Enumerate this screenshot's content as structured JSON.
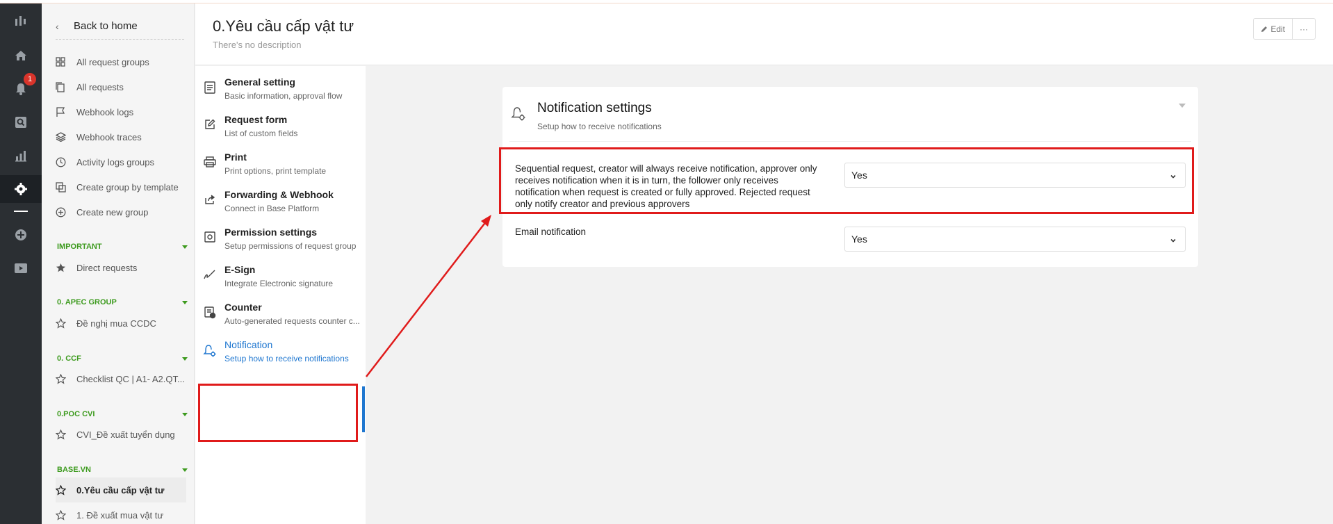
{
  "notification_badge": "1",
  "sidebar": {
    "back_label": "Back to home",
    "items": [
      {
        "label": "All request groups",
        "icon": "grid-icon"
      },
      {
        "label": "All requests",
        "icon": "copy-icon"
      },
      {
        "label": "Webhook logs",
        "icon": "flag-icon"
      },
      {
        "label": "Webhook traces",
        "icon": "layers-icon"
      },
      {
        "label": "Activity logs groups",
        "icon": "clock-icon"
      },
      {
        "label": "Create group by template",
        "icon": "template-icon"
      },
      {
        "label": "Create new group",
        "icon": "plus-circle-icon"
      }
    ],
    "groups": [
      {
        "name": "IMPORTANT",
        "items": [
          "Direct requests"
        ]
      },
      {
        "name": "0. APEC GROUP",
        "items": [
          "Đề nghị mua CCDC"
        ]
      },
      {
        "name": "0. CCF",
        "items": [
          "Checklist QC | A1- A2.QT..."
        ]
      },
      {
        "name": "0.POC CVI",
        "items": [
          "CVI_Đề xuất tuyển dụng"
        ]
      },
      {
        "name": "BASE.VN",
        "items": [
          "0.Yêu cầu cấp vật tư",
          "1. Đề xuất mua vật tư"
        ]
      }
    ]
  },
  "header": {
    "title": "0.Yêu cầu cấp vật tư",
    "description": "There's no description",
    "edit_label": "Edit",
    "more_label": "···"
  },
  "settings_menu": [
    {
      "label": "General setting",
      "sub": "Basic information, approval flow",
      "icon": "document-icon"
    },
    {
      "label": "Request form",
      "sub": "List of custom fields",
      "icon": "edit-icon"
    },
    {
      "label": "Print",
      "sub": "Print options, print template",
      "icon": "printer-icon"
    },
    {
      "label": "Forwarding & Webhook",
      "sub": "Connect in Base Platform",
      "icon": "share-icon"
    },
    {
      "label": "Permission settings",
      "sub": "Setup permissions of request group",
      "icon": "permission-icon"
    },
    {
      "label": "E-Sign",
      "sub": "Integrate Electronic signature",
      "icon": "signature-icon"
    },
    {
      "label": "Counter",
      "sub": "Auto-generated requests counter c...",
      "icon": "counter-icon"
    },
    {
      "label": "Notification",
      "sub": "Setup how to receive notifications",
      "icon": "bell-gear-icon"
    }
  ],
  "card": {
    "title": "Notification settings",
    "subtitle": "Setup how to receive notifications",
    "rows": [
      {
        "label": "Sequential request, creator will always receive notification, approver only receives notification when it is in turn, the follower only receives notification when request is created or fully approved. Rejected request only notify creator and previous approvers",
        "value": "Yes"
      },
      {
        "label": "Email notification",
        "value": "Yes"
      }
    ]
  },
  "colors": {
    "accent": "#1f77d0",
    "group_label": "#3c9a1d",
    "annotation": "#e01b1b",
    "rail": "#2b2f33"
  }
}
